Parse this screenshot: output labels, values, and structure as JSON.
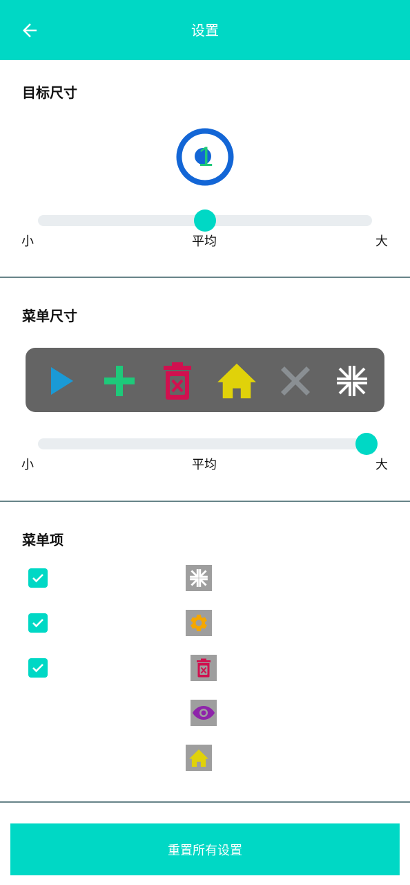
{
  "header": {
    "title": "设置",
    "back_icon": "arrow-left-icon"
  },
  "target_size": {
    "title": "目标尺寸",
    "preview_number": "1",
    "slider": {
      "min_label": "小",
      "mid_label": "平均",
      "max_label": "大",
      "value_percent": 50
    }
  },
  "menu_size": {
    "title": "菜单尺寸",
    "icons": [
      "play-icon",
      "plus-icon",
      "trash-icon",
      "home-icon",
      "close-icon",
      "collapse-icon"
    ],
    "slider": {
      "min_label": "小",
      "mid_label": "平均",
      "max_label": "大",
      "value_percent": 100
    }
  },
  "menu_items": {
    "title": "菜单项",
    "items": [
      {
        "icon": "collapse-icon",
        "checked": true
      },
      {
        "icon": "gear-icon",
        "checked": true
      },
      {
        "icon": "trash-icon",
        "checked": true
      },
      {
        "icon": "eye-icon",
        "checked": false
      },
      {
        "icon": "home-icon",
        "checked": false
      }
    ]
  },
  "reset_button": {
    "label": "重置所有设置"
  },
  "colors": {
    "accent": "#00d8c5",
    "menu_bar": "#646464",
    "play": "#1a9ad6",
    "plus": "#1ec97a",
    "trash": "#d0104f",
    "home": "#e0d20a",
    "close": "#8a8f93",
    "gear": "#f5a700",
    "eye": "#8e24aa"
  }
}
